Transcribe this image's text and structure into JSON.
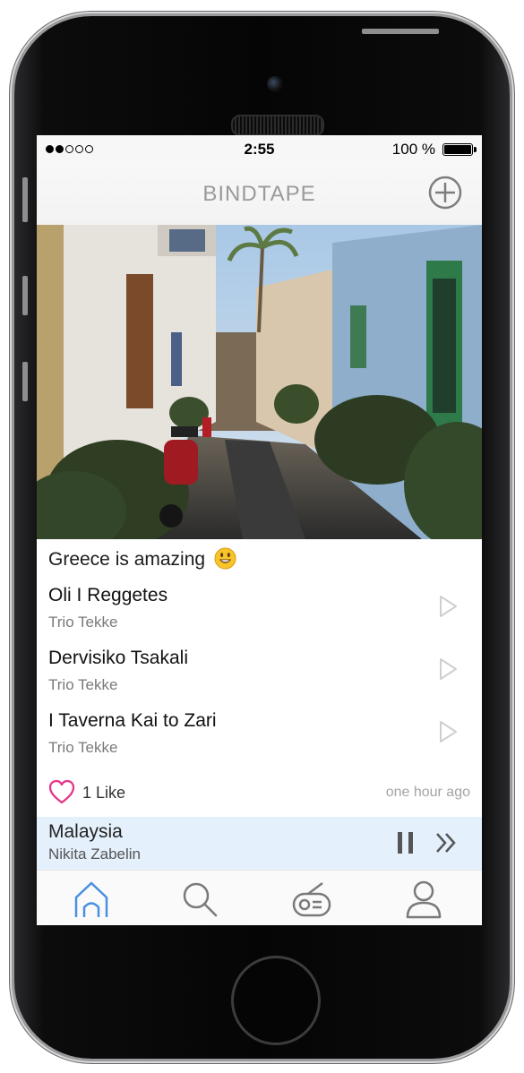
{
  "status_bar": {
    "signal_dots_filled": 2,
    "signal_dots_total": 5,
    "time": "2:55",
    "battery_text": "100 %",
    "battery_level": 1.0
  },
  "nav": {
    "title": "BINDTAPE",
    "add_icon": "plus-circle-icon"
  },
  "post": {
    "caption": "Greece is amazing",
    "caption_emoji": "smiley-face-emoji",
    "tracks": [
      {
        "title": "Oli I Reggetes",
        "artist": "Trio Tekke"
      },
      {
        "title": "Dervisiko Tsakali",
        "artist": "Trio Tekke"
      },
      {
        "title": "I Taverna Kai to Zari",
        "artist": "Trio Tekke"
      }
    ],
    "likes": "1 Like",
    "time_ago": "one hour ago"
  },
  "now_playing": {
    "title": "Malaysia",
    "artist": "Nikita Zabelin"
  },
  "tabs": [
    {
      "icon": "home-icon",
      "active": true
    },
    {
      "icon": "search-icon",
      "active": false
    },
    {
      "icon": "radio-icon",
      "active": false
    },
    {
      "icon": "profile-icon",
      "active": false
    }
  ],
  "colors": {
    "accent": "#4a8fe0",
    "like_heart": "#e5358a",
    "now_playing_bg": "#e4f0fb",
    "nav_title": "#9a9a9a"
  }
}
